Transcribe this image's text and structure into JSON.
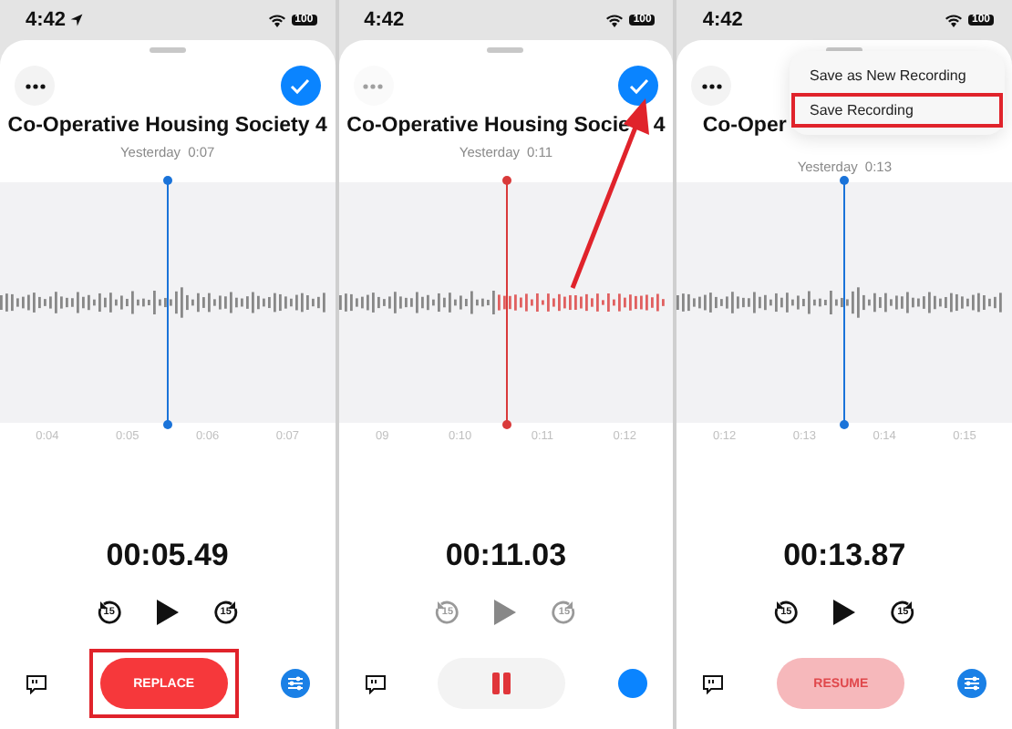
{
  "panels": [
    {
      "status_time": "4:42",
      "location_on": true,
      "battery": "100",
      "more_dimmed": false,
      "done": true,
      "arrow_to_done": false,
      "title": "Co-Operative Housing Society 4",
      "date": "Yesterday",
      "duration": "0:07",
      "color": "#1a73d9",
      "recording": false,
      "ticks": [
        "0:04",
        "0:05",
        "0:06",
        "0:07"
      ],
      "time": "00:05.49",
      "skip_back": "15",
      "skip_forward": "15",
      "transport_enabled": true,
      "main_button": {
        "kind": "replace",
        "label": "REPLACE",
        "highlighted": true
      },
      "right_control": {
        "kind": "sliders"
      }
    },
    {
      "status_time": "4:42",
      "location_on": false,
      "battery": "100",
      "more_dimmed": true,
      "done": true,
      "arrow_to_done": true,
      "title": "Co-Operative Housing Socie",
      "title_tail": "4",
      "date": "Yesterday",
      "duration": "0:11",
      "color": "#d93a3a",
      "recording": true,
      "ticks": [
        "09",
        "0:10",
        "0:11",
        "0:12"
      ],
      "time": "00:11.03",
      "skip_back": "15",
      "skip_forward": "15",
      "transport_enabled": false,
      "main_button": {
        "kind": "pause",
        "highlighted": false
      },
      "right_control": {
        "kind": "dot"
      }
    },
    {
      "status_time": "4:42",
      "location_on": false,
      "battery": "100",
      "more_dimmed": false,
      "done": false,
      "arrow_to_done": false,
      "title": "Co-Oper",
      "menu": [
        {
          "label": "Save as New Recording",
          "highlighted": false
        },
        {
          "label": "Save Recording",
          "highlighted": true
        }
      ],
      "date": "Yesterday",
      "duration": "0:13",
      "color": "#1a73d9",
      "recording": false,
      "ticks": [
        "0:12",
        "0:13",
        "0:14",
        "0:15"
      ],
      "time": "00:13.87",
      "skip_back": "15",
      "skip_forward": "15",
      "transport_enabled": true,
      "main_button": {
        "kind": "resume",
        "label": "RESUME",
        "highlighted": false
      },
      "right_control": {
        "kind": "sliders"
      }
    }
  ]
}
